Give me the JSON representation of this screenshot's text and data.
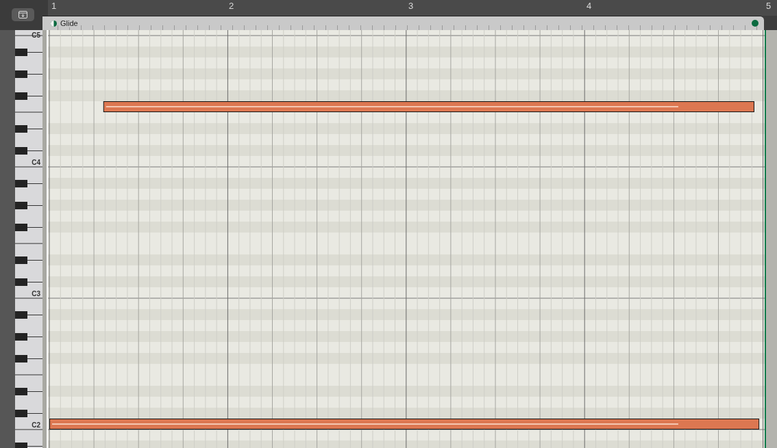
{
  "ruler": {
    "bars": [
      "1",
      "2",
      "3",
      "4",
      "5"
    ]
  },
  "region": {
    "name": "Glide"
  },
  "keyboard": {
    "labels": [
      "C5",
      "C4",
      "C3",
      "C2"
    ]
  }
}
